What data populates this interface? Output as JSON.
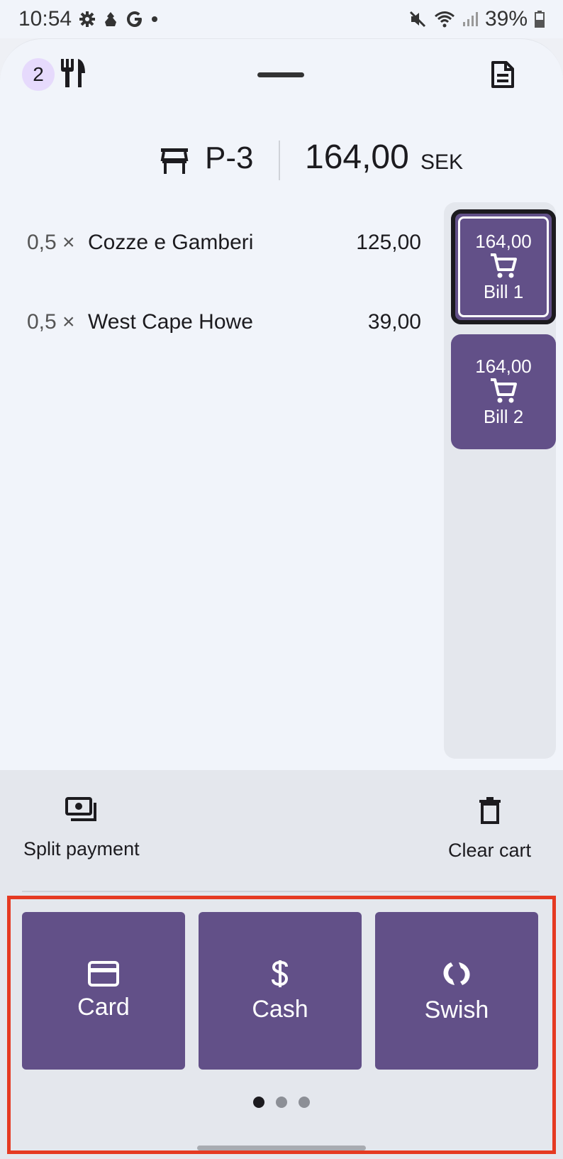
{
  "status_bar": {
    "time": "10:54",
    "battery": "39%"
  },
  "top_bar": {
    "table_badge_count": "2"
  },
  "header": {
    "table_name": "P-3",
    "total": "164,00",
    "currency": "SEK"
  },
  "order_items": [
    {
      "qty": "0,5 ×",
      "name": "Cozze e Gamberi",
      "price": "125,00"
    },
    {
      "qty": "0,5 ×",
      "name": "West Cape Howe",
      "price": "39,00"
    }
  ],
  "bills": [
    {
      "amount": "164,00",
      "name": "Bill 1",
      "selected": true
    },
    {
      "amount": "164,00",
      "name": "Bill 2",
      "selected": false
    }
  ],
  "actions": {
    "split_payment": "Split payment",
    "clear_cart": "Clear cart"
  },
  "payment_methods": [
    {
      "label": "Card",
      "icon": "credit-card-icon"
    },
    {
      "label": "Cash",
      "icon": "dollar-icon"
    },
    {
      "label": "Swish",
      "icon": "swish-icon"
    }
  ],
  "pager": {
    "pages": 3,
    "active": 1
  },
  "colors": {
    "primary": "#625088",
    "badge": "#e6dafc",
    "highlight": "#e53a22"
  }
}
